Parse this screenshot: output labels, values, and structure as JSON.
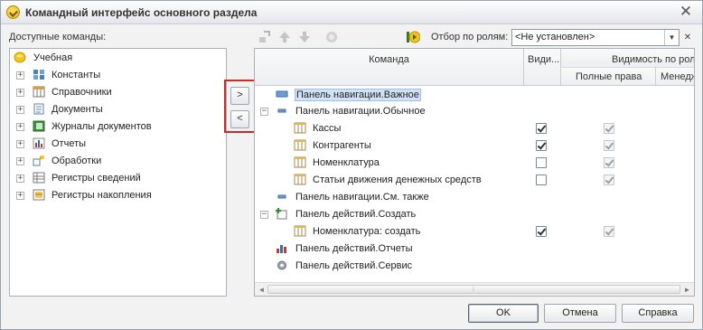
{
  "window": {
    "title": "Командный интерфейс основного раздела",
    "close_glyph": "✕"
  },
  "available": {
    "label": "Доступные команды:",
    "root": "Учебная",
    "items": [
      {
        "label": "Константы",
        "icon": "constants-icon"
      },
      {
        "label": "Справочники",
        "icon": "catalogs-icon"
      },
      {
        "label": "Документы",
        "icon": "documents-icon"
      },
      {
        "label": "Журналы документов",
        "icon": "journals-icon"
      },
      {
        "label": "Отчеты",
        "icon": "reports-icon"
      },
      {
        "label": "Обработки",
        "icon": "processing-icon"
      },
      {
        "label": "Регистры сведений",
        "icon": "info-registers-icon"
      },
      {
        "label": "Регистры накопления",
        "icon": "accumulation-registers-icon"
      }
    ],
    "expand_glyph": "+"
  },
  "move_buttons": {
    "add": ">",
    "remove": "<"
  },
  "filter": {
    "label": "Отбор по ролям:",
    "value": "<Не установлен>",
    "dropdown_glyph": "▼",
    "clear_glyph": "✕"
  },
  "commands": {
    "headers": {
      "command": "Команда",
      "visible": "Види...",
      "role_visibility": "Видимость по ролям",
      "full_rights": "Полные права",
      "manager": "Менеджер"
    },
    "rows": [
      {
        "label": "Панель навигации.Важное",
        "level": 0,
        "icon": "nav-panel-important-icon",
        "selected": true,
        "visible": null,
        "full": null
      },
      {
        "label": "Панель навигации.Обычное",
        "level": 0,
        "icon": "nav-panel-normal-icon",
        "expander": "−",
        "visible": null,
        "full": null
      },
      {
        "label": "Кассы",
        "level": 1,
        "icon": "catalog-icon",
        "visible": true,
        "full": true
      },
      {
        "label": "Контрагенты",
        "level": 1,
        "icon": "catalog-icon",
        "visible": true,
        "full": true
      },
      {
        "label": "Номенклатура",
        "level": 1,
        "icon": "catalog-icon",
        "visible": false,
        "full": true
      },
      {
        "label": "Статьи движения денежных средств",
        "level": 1,
        "icon": "catalog-icon",
        "visible": false,
        "full": true
      },
      {
        "label": "Панель навигации.См. также",
        "level": 0,
        "icon": "nav-panel-see-also-icon",
        "visible": null,
        "full": null
      },
      {
        "label": "Панель действий.Создать",
        "level": 0,
        "icon": "action-create-icon",
        "expander": "−",
        "visible": null,
        "full": null
      },
      {
        "label": "Номенклатура: создать",
        "level": 1,
        "icon": "catalog-icon",
        "visible": true,
        "full": true
      },
      {
        "label": "Панель действий.Отчеты",
        "level": 0,
        "icon": "action-reports-icon",
        "visible": null,
        "full": null
      },
      {
        "label": "Панель действий.Сервис",
        "level": 0,
        "icon": "action-service-icon",
        "visible": null,
        "full": null
      }
    ]
  },
  "scroll": {
    "left": "◄",
    "right": "►",
    "grip": "⁞"
  },
  "buttons": {
    "ok": "OK",
    "cancel": "Отмена",
    "help": "Справка"
  },
  "colors": {
    "selection": "#cfe2f6",
    "highlight_frame": "#c92b2b"
  }
}
